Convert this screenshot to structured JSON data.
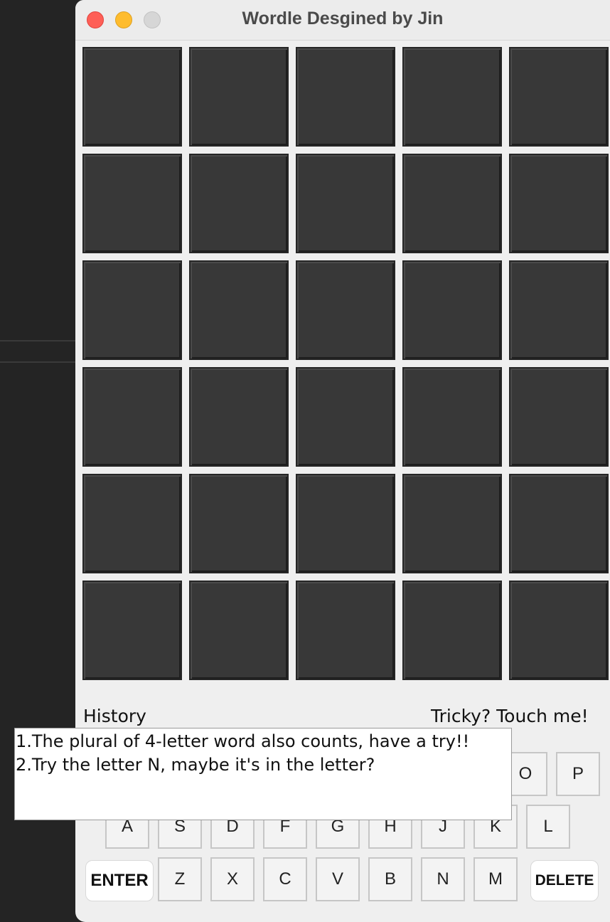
{
  "window": {
    "title": "Wordle Desgined by Jin"
  },
  "board": {
    "rows": 6,
    "cols": 5,
    "tile_color": "#383838"
  },
  "labels": {
    "history": "History",
    "tricky": "Tricky? Touch me!"
  },
  "hints": {
    "lines": [
      "1.The plural of 4-letter word also counts, have a try!!",
      "2.Try the letter N, maybe it's in the letter?"
    ]
  },
  "keyboard": {
    "row1_visible": [
      "O",
      "P"
    ],
    "row2": [
      "A",
      "S",
      "D",
      "F",
      "G",
      "H",
      "J",
      "K",
      "L"
    ],
    "row3": [
      "Z",
      "X",
      "C",
      "V",
      "B",
      "N",
      "M"
    ],
    "enter_label": "ENTER",
    "delete_label": "DELETE"
  },
  "colors": {
    "close": "#fe5f57",
    "minimize": "#febc2e",
    "zoom": "#d6d6d6"
  }
}
